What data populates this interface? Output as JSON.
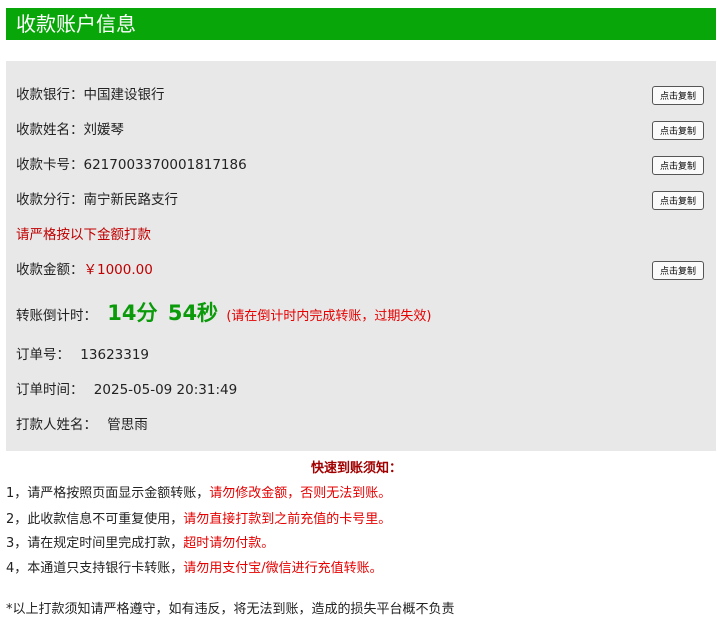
{
  "header": {
    "title": "收款账户信息"
  },
  "info": {
    "bank": {
      "label": "收款银行：",
      "value": "中国建设银行"
    },
    "name": {
      "label": "收款姓名：",
      "value": "刘媛琴"
    },
    "card": {
      "label": "收款卡号：",
      "value": "6217003370001817186"
    },
    "branch": {
      "label": "收款分行：",
      "value": "南宁新民路支行"
    },
    "warning": "请严格按以下金额打款",
    "amount": {
      "label": "收款金额：",
      "value": "￥1000.00"
    },
    "countdown": {
      "label": "转账倒计时：",
      "minutes": "14分",
      "seconds": "54秒",
      "note": "(请在倒计时内完成转账，过期失效)"
    },
    "order_no": {
      "label": "订单号：",
      "value": "13623319"
    },
    "order_time": {
      "label": "订单时间：",
      "value": "2025-05-09 20:31:49"
    },
    "payer": {
      "label": "打款人姓名：",
      "value": "管思雨"
    },
    "copy_label": "点击复制"
  },
  "notice": {
    "title": "快速到账须知：",
    "items": [
      {
        "black": "1，请严格按照页面显示金额转账，",
        "red": "请勿修改金额，否则无法到账。"
      },
      {
        "black": "2，此收款信息不可重复使用，",
        "red": "请勿直接打款到之前充值的卡号里。"
      },
      {
        "black": "3，请在规定时间里完成打款，",
        "red": "超时请勿付款。"
      },
      {
        "black": "4，本通道只支持银行卡转账，",
        "red": "请勿用支付宝/微信进行充值转账。"
      }
    ],
    "footer": "*以上打款须知请严格遵守，如有违反，将无法到账，造成的损失平台概不负责"
  },
  "colors": {
    "header_bg": "#09a60a",
    "panel_bg": "#e8e8e8",
    "timer": "#0a9a0a",
    "warning": "#c00000",
    "notice_red": "#e60000"
  }
}
